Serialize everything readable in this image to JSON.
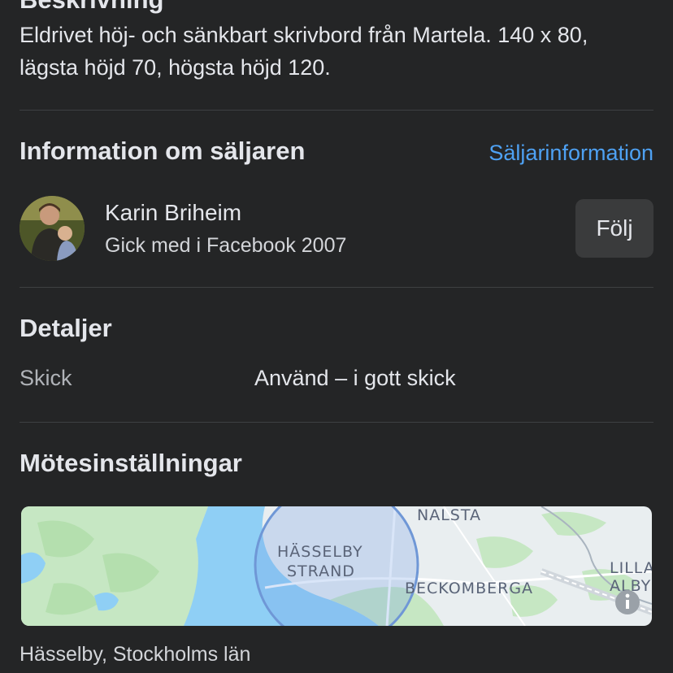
{
  "description": {
    "heading": "Beskrivning",
    "text_line1": "Eldrivet höj- och sänkbart skrivbord från Martela. 140 x 80,",
    "text_line2": "lägsta höjd 70, högsta höjd 120."
  },
  "seller": {
    "heading": "Information om säljaren",
    "info_link": "Säljarinformation",
    "name": "Karin Briheim",
    "joined": "Gick med i Facebook 2007",
    "follow_label": "Följ"
  },
  "details": {
    "heading": "Detaljer",
    "condition_label": "Skick",
    "condition_value": "Använd – i gott skick"
  },
  "meeting": {
    "heading": "Mötesinställningar",
    "map_labels": {
      "nalsta": "NALSTA",
      "hasselby_1": "HÄSSELBY",
      "hasselby_2": "STRAND",
      "beckomberga": "BECKOMBERGA",
      "lilla_1": "LILLA",
      "lilla_2": "ALBY"
    },
    "location": "Hässelby, Stockholms län"
  },
  "colors": {
    "background": "#242526",
    "text": "#e4e6eb",
    "link": "#4ea1f3",
    "button": "#3a3b3c"
  }
}
